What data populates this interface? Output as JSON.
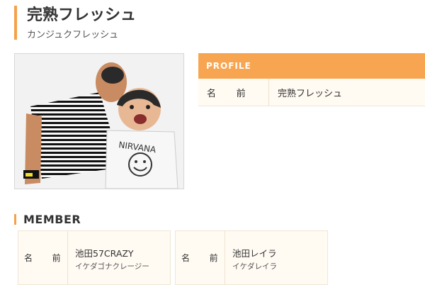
{
  "header": {
    "title": "完熟フレッシュ",
    "kana": "カンジュクフレッシュ"
  },
  "photo": {
    "name": "duo-photo"
  },
  "profile": {
    "heading": "PROFILE",
    "rows": [
      {
        "label": "名　前",
        "value": "完熟フレッシュ"
      }
    ]
  },
  "members": {
    "heading": "MEMBER",
    "items": [
      {
        "label": "名　前",
        "name": "池田57CRAZY",
        "reading": "イケダゴナクレージー"
      },
      {
        "label": "名　前",
        "name": "池田レイラ",
        "reading": "イケダレイラ"
      }
    ]
  },
  "colors": {
    "accent": "#f8a552",
    "table_bg": "#fffaf2"
  }
}
